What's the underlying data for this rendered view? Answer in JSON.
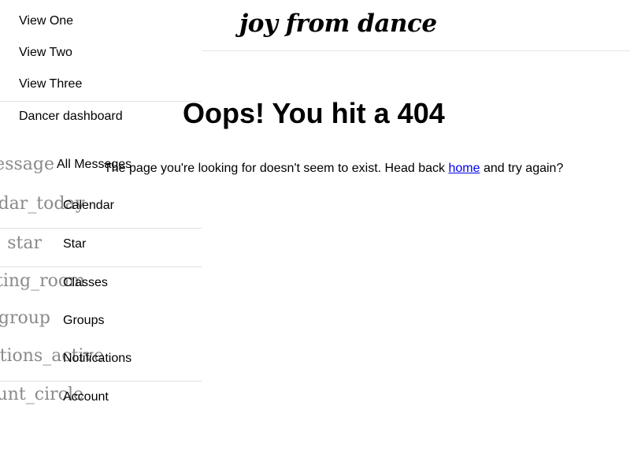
{
  "brand": "joy from dance",
  "drawer": {
    "top_links": [
      "View One",
      "View Two",
      "View Three"
    ],
    "dashboard_link": "Dancer dashboard",
    "items": [
      {
        "icon": "message",
        "label": "All Messages"
      },
      {
        "icon": "calendar_today",
        "label": "Calendar"
      },
      {
        "icon": "star",
        "label": "Star"
      },
      {
        "icon": "meeting_room",
        "label": "Classes"
      },
      {
        "icon": "group",
        "label": "Groups"
      },
      {
        "icon": "notifications_active",
        "label": "Notifications"
      },
      {
        "icon": "account_circle",
        "label": "Account"
      }
    ]
  },
  "main": {
    "title": "Oops! You hit a 404",
    "message_before": "The page you're looking for doesn't seem to exist. Head back ",
    "message_link": "home",
    "message_after": " and try again?"
  }
}
